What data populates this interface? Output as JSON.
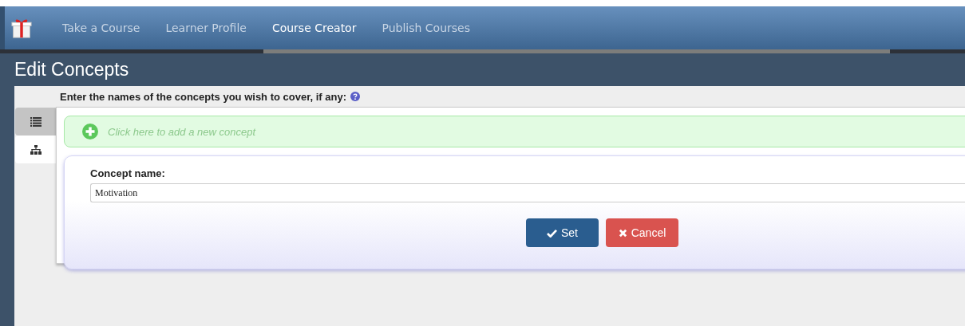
{
  "nav": {
    "items": [
      {
        "label": "Take a Course",
        "selected": false
      },
      {
        "label": "Learner Profile",
        "selected": false
      },
      {
        "label": "Course Creator",
        "selected": true
      },
      {
        "label": "Publish Courses",
        "selected": false
      }
    ]
  },
  "page_title": "Edit Concepts",
  "instruction": "Enter the names of the concepts you wish to cover, if any:",
  "side_tabs": [
    {
      "kind": "list",
      "selected": true
    },
    {
      "kind": "tree",
      "selected": false
    }
  ],
  "add_prompt": "Click here to add a new concept",
  "editor": {
    "label": "Concept name:",
    "value": "Motivation",
    "buttons": [
      {
        "kind": "confirm",
        "label": "Set"
      },
      {
        "kind": "cancel",
        "label": "Cancel"
      }
    ]
  }
}
